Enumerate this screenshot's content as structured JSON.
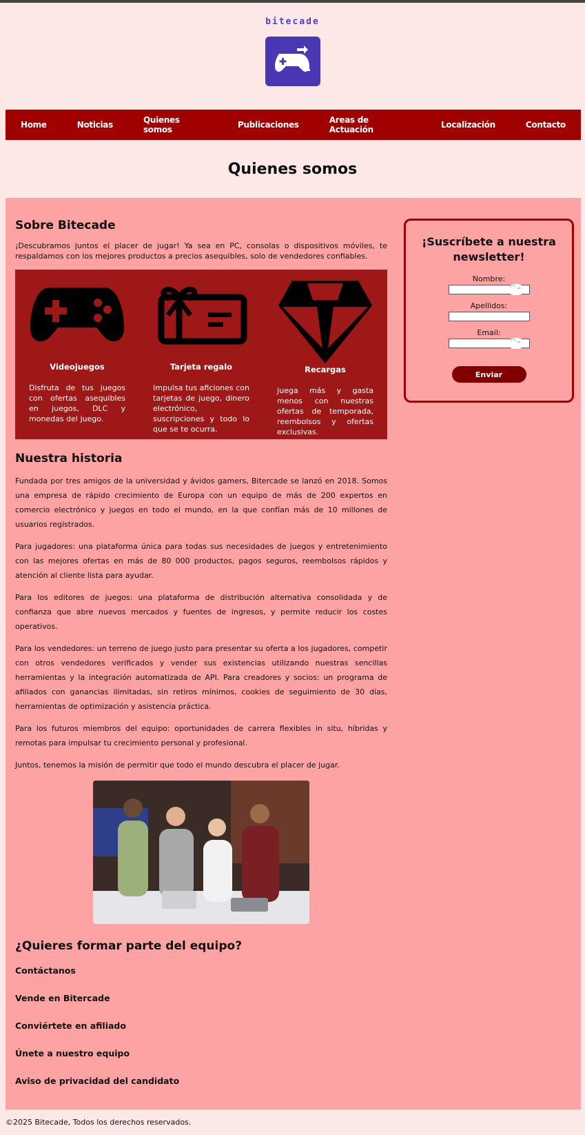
{
  "brand": {
    "name": "bitecade"
  },
  "nav": [
    "Home",
    "Noticias",
    "Quienes somos",
    "Publicaciones",
    "Areas de Actuación",
    "Localización",
    "Contacto"
  ],
  "page_title": "Quienes somos",
  "about": {
    "title": "Sobre Bitecade",
    "intro": "¡Descubramos juntos el placer de jugar! Ya sea en PC, consolas o dispositivos móviles, te respaldamos con los mejores productos a precios asequibles, solo de vendedores confiables."
  },
  "features": [
    {
      "icon": "gamepad-icon",
      "title": "Videojuegos",
      "desc": "Disfruta de tus juegos con ofertas asequibles en juegos, DLC y monedas del juego."
    },
    {
      "icon": "gift-card-icon",
      "title": "Tarjeta regalo",
      "desc": "Impulsa tus aficiones con tarjetas de juego, dinero electrónico, suscripciones y todo lo que se te ocurra."
    },
    {
      "icon": "diamond-icon",
      "title": "Recargas",
      "desc": "Juega más y gasta menos con nuestras ofertas de temporada, reembolsos y ofertas exclusivas."
    }
  ],
  "history": {
    "title": "Nuestra historia",
    "paragraphs": [
      "Fundada por tres amigos de la universidad y ávidos gamers, Bitercade se lanzó en 2018. Somos una empresa de rápido crecimiento de Europa con un equipo de más de 200 expertos en comercio electrónico y juegos en todo el mundo, en la que confían más de 10 millones de usuarios registrados.",
      "Para jugadores: una plataforma única para todas sus necesidades de juegos y entretenimiento con las mejores ofertas en más de 80 000 productos, pagos seguros, reembolsos rápidos y atención al cliente lista para ayudar.",
      "Para los editores de juegos: una plataforma de distribución alternativa consolidada y de confianza que abre nuevos mercados y fuentes de ingresos, y permite reducir los costes operativos.",
      "Para los vendedores: un terreno de juego justo para presentar su oferta a los jugadores, competir con otros vendedores verificados y vender sus existencias utilizando nuestras sencillas herramientas y la integración automatizada de API. Para creadores y socios: un programa de afiliados con ganancias ilimitadas, sin retiros mínimos, cookies de seguimiento de 30 días, herramientas de optimización y asistencia práctica.",
      "Para los futuros miembros del equipo: oportunidades de carrera flexibles in situ, híbridas y remotas para impulsar tu crecimiento personal y profesional.",
      "Juntos, tenemos la misión de permitir que todo el mundo descubra el placer de jugar."
    ]
  },
  "join": {
    "title": "¿Quieres formar parte del equipo?",
    "items": [
      "Contáctanos",
      "Vende en Bitercade",
      "Conviértete en afiliado",
      "Únete a nuestro equipo",
      "Aviso de privacidad del candidato"
    ]
  },
  "newsletter": {
    "title": "¡Suscríbete a nuestra newsletter!",
    "fields": [
      "Nombre:",
      "Apellidos:",
      "Email:"
    ],
    "submit": "Enviar"
  },
  "footer": "©2025 Bitecade, Todos los derechos reservados."
}
